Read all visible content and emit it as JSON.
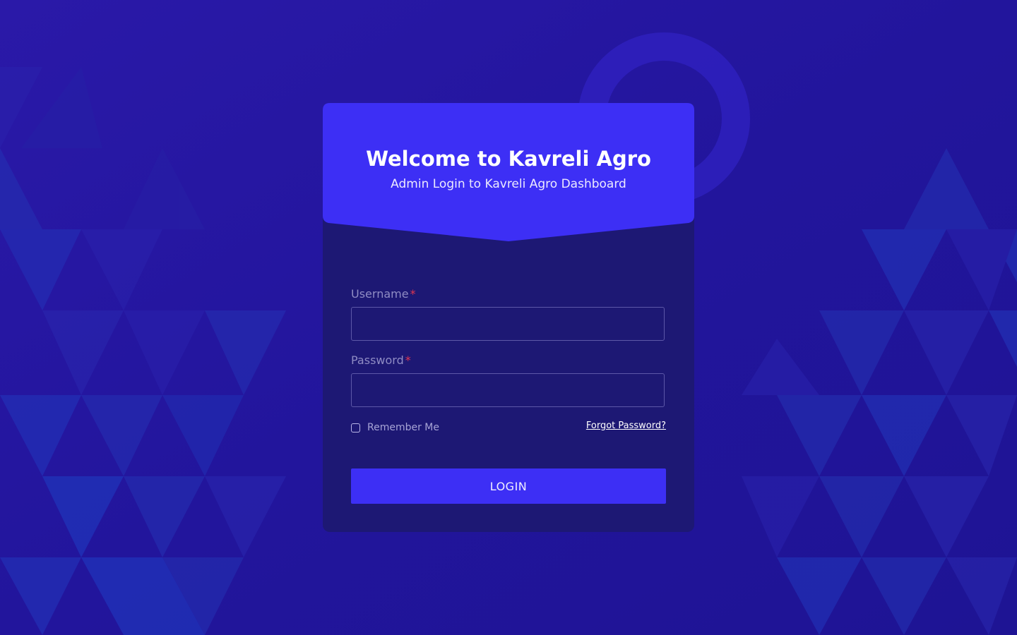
{
  "header": {
    "welcome_prefix": "Welcome to ",
    "brand_name": "Kavreli Agro",
    "subtitle": "Admin Login to Kavreli Agro Dashboard"
  },
  "form": {
    "username_label": "Username",
    "password_label": "Password",
    "required_marker": "*",
    "username_value": "",
    "password_value": "",
    "remember_label": "Remember Me",
    "remember_checked": false,
    "forgot_label": "Forgot Password?",
    "login_label": "LOGIN"
  },
  "colors": {
    "background": "#21169a",
    "card": "#1d1874",
    "header": "#3d2ff5",
    "button": "#3d2ff5",
    "required": "#e0364f"
  }
}
